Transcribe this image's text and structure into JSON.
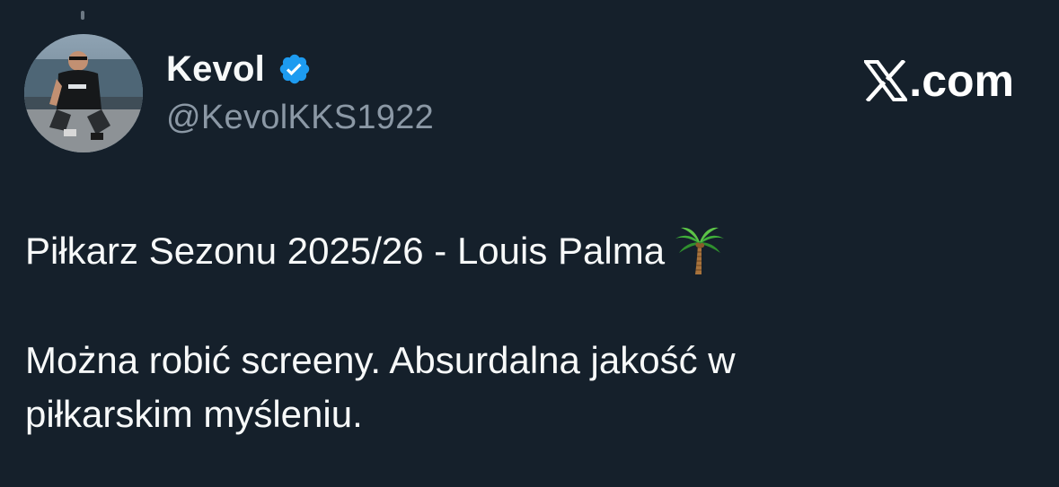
{
  "author": {
    "display_name": "Kevol",
    "handle": "@KevolKKS1922",
    "verified": true,
    "avatar": "profile-photo-man-crouching-by-water"
  },
  "brand": {
    "text": ".com",
    "logo": "x-logo"
  },
  "tweet": {
    "line_1": "Piłkarz Sezonu 2025/26 - Louis Palma",
    "line_1_emoji": "palm-tree-icon",
    "line_2": "Można robić screeny. Absurdalna jakość w",
    "line_3": "piłkarskim myśleniu."
  },
  "colors": {
    "background": "#15202b",
    "text": "#f7f9f9",
    "secondary_text": "#8b98a5",
    "verified": "#1d9bf0"
  }
}
